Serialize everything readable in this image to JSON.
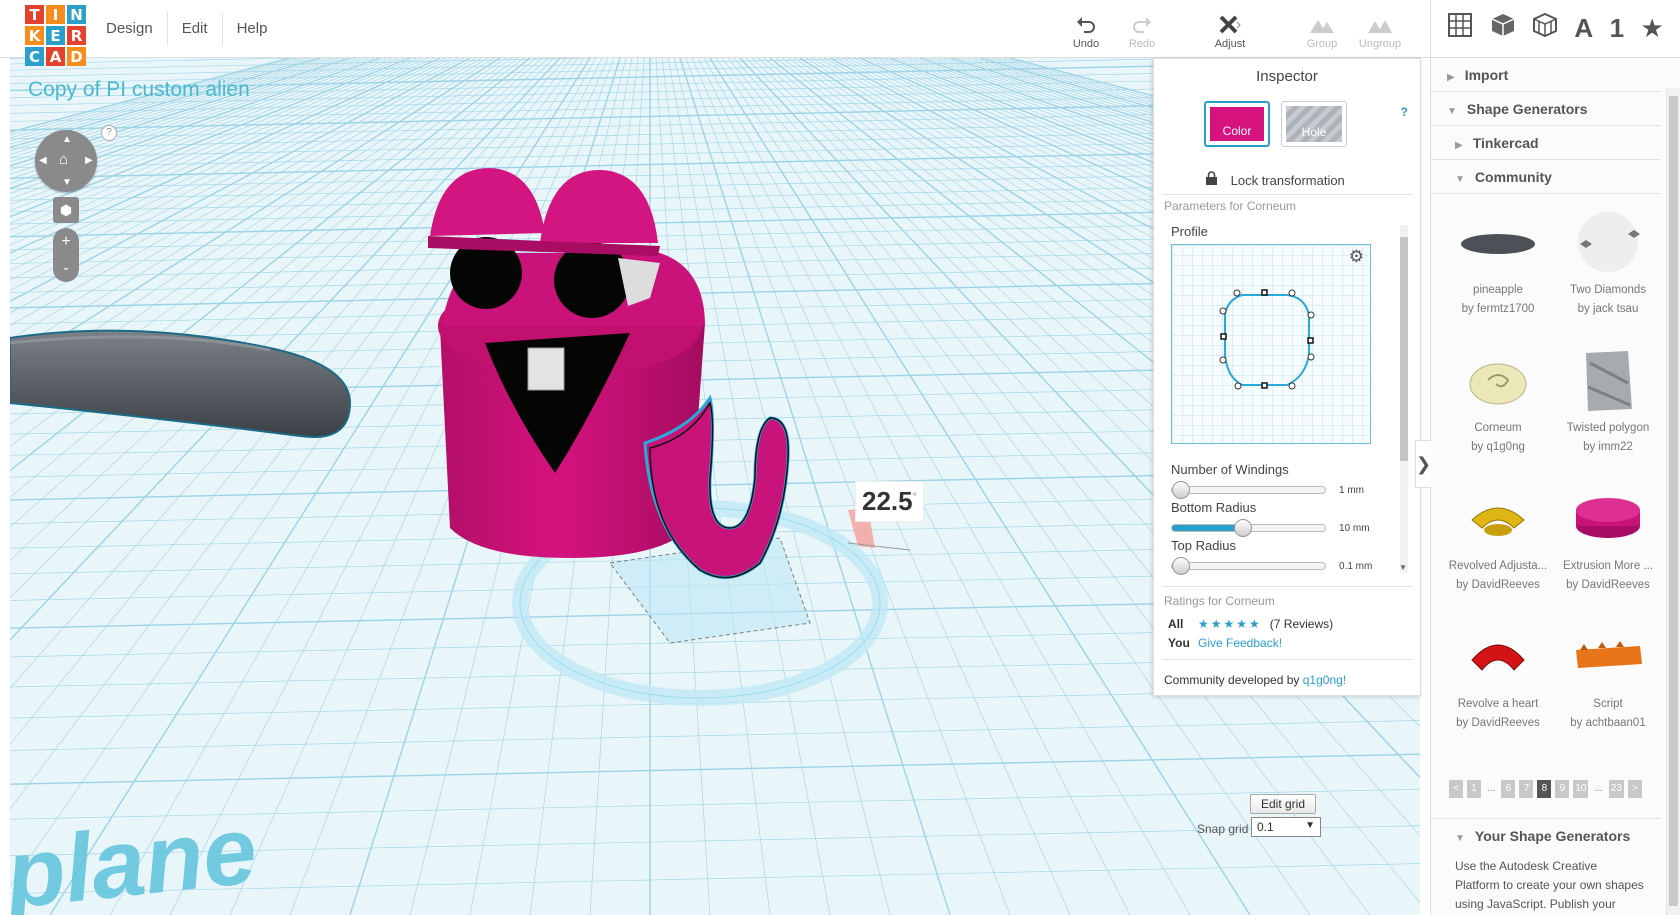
{
  "app": {
    "logo_letters": [
      "T",
      "I",
      "N",
      "K",
      "E",
      "R",
      "C",
      "A",
      "D"
    ],
    "logo_colors": [
      "#e5412f",
      "#f58c1e",
      "#2a9fc9",
      "#f58c1e",
      "#2a9fc9",
      "#e5412f",
      "#2a9fc9",
      "#e5412f",
      "#f58c1e"
    ],
    "menu": [
      "Design",
      "Edit",
      "Help"
    ]
  },
  "toolbar": {
    "undo": "Undo",
    "redo": "Redo",
    "adjust": "Adjust",
    "group": "Group",
    "ungroup": "Ungroup"
  },
  "viewbar": {
    "text_tool": "A",
    "number_tool": "1",
    "favorites": "★"
  },
  "design": {
    "title": "Copy of PI custom alien",
    "plane_text": "plane"
  },
  "workplane": {
    "angle_value": "22.5",
    "angle_unit": "°",
    "edit_grid": "Edit grid",
    "snap_label": "Snap grid",
    "snap_value": "0.1"
  },
  "inspector": {
    "title": "Inspector",
    "color_label": "Color",
    "hole_label": "Hole",
    "help": "?",
    "lock_label": "Lock transformation",
    "params_header": "Parameters for Corneum",
    "profile_label": "Profile",
    "windings_label": "Number of Windings",
    "windings_value": "1 mm",
    "windings_fraction": 0.0,
    "bottom_radius_label": "Bottom Radius",
    "bottom_radius_value": "10 mm",
    "bottom_radius_fraction": 0.45,
    "top_radius_label": "Top Radius",
    "top_radius_value": "0.1 mm",
    "top_radius_fraction": 0.0,
    "ratings_header": "Ratings for Corneum",
    "ratings_all_label": "All",
    "ratings_stars": "★★★★★",
    "ratings_count": "(7 Reviews)",
    "ratings_you_label": "You",
    "give_feedback": "Give Feedback!",
    "community_prefix": "Community developed by",
    "community_author": "q1g0ng!",
    "color_hex": "#d6127f"
  },
  "sidebar": {
    "import": "Import",
    "shape_generators": "Shape Generators",
    "tinkercad": "Tinkercad",
    "community": "Community",
    "items": [
      {
        "name": "pineapple",
        "author": "by fermtz1700"
      },
      {
        "name": "Two Diamonds",
        "author": "by jack tsau"
      },
      {
        "name": "Corneum",
        "author": "by q1g0ng"
      },
      {
        "name": "Twisted polygon",
        "author": "by imm22"
      },
      {
        "name": "Revolved Adjusta...",
        "author": "by DavidReeves"
      },
      {
        "name": "Extrusion More ...",
        "author": "by DavidReeves"
      },
      {
        "name": "Revolve a heart",
        "author": "by DavidReeves"
      },
      {
        "name": "Script",
        "author": "by achtbaan01"
      }
    ],
    "pager": [
      "<",
      "1",
      "...",
      "6",
      "7",
      "8",
      "9",
      "10",
      "...",
      "23",
      ">"
    ],
    "pager_active": "8",
    "your_shape_generators": "Your Shape Generators",
    "ysg_text": "Use the Autodesk Creative Platform to create your own shapes using JavaScript. Publish your shapes to"
  }
}
